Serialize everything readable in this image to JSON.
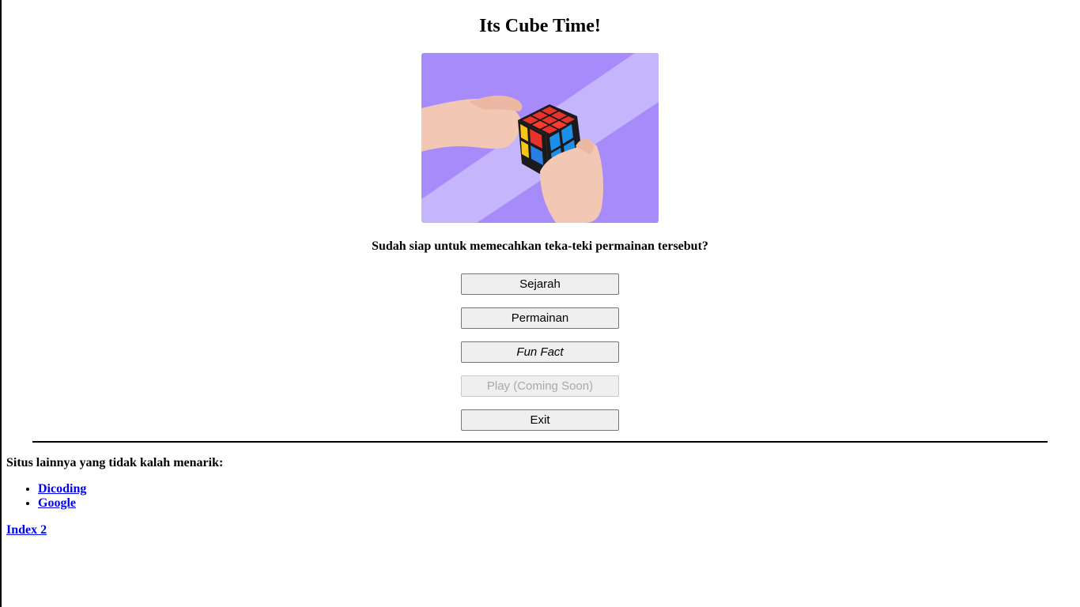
{
  "header": {
    "title": "Its Cube Time!"
  },
  "hero": {
    "image": "rubiks-cube-hands-photo",
    "background_color": "#a78bfa",
    "stripe_color": "#c4b5fd"
  },
  "main": {
    "question": "Sudah siap untuk memecahkan teka-teki permainan tersebut?",
    "buttons": [
      {
        "label": "Sejarah",
        "enabled": true
      },
      {
        "label": "Permainan",
        "enabled": true
      },
      {
        "label": "Fun Fact",
        "enabled": true
      },
      {
        "label": "Play (Coming Soon)",
        "enabled": false
      },
      {
        "label": "Exit",
        "enabled": true
      }
    ]
  },
  "footer": {
    "heading": "Situs lainnya yang tidak kalah menarik:",
    "links": [
      {
        "label": "Dicoding"
      },
      {
        "label": "Google"
      }
    ],
    "index_link": "Index 2"
  },
  "colors": {
    "link": "#0000ee",
    "button_bg": "#efefef",
    "button_border": "#767676",
    "disabled_text": "#a9a9a9"
  }
}
